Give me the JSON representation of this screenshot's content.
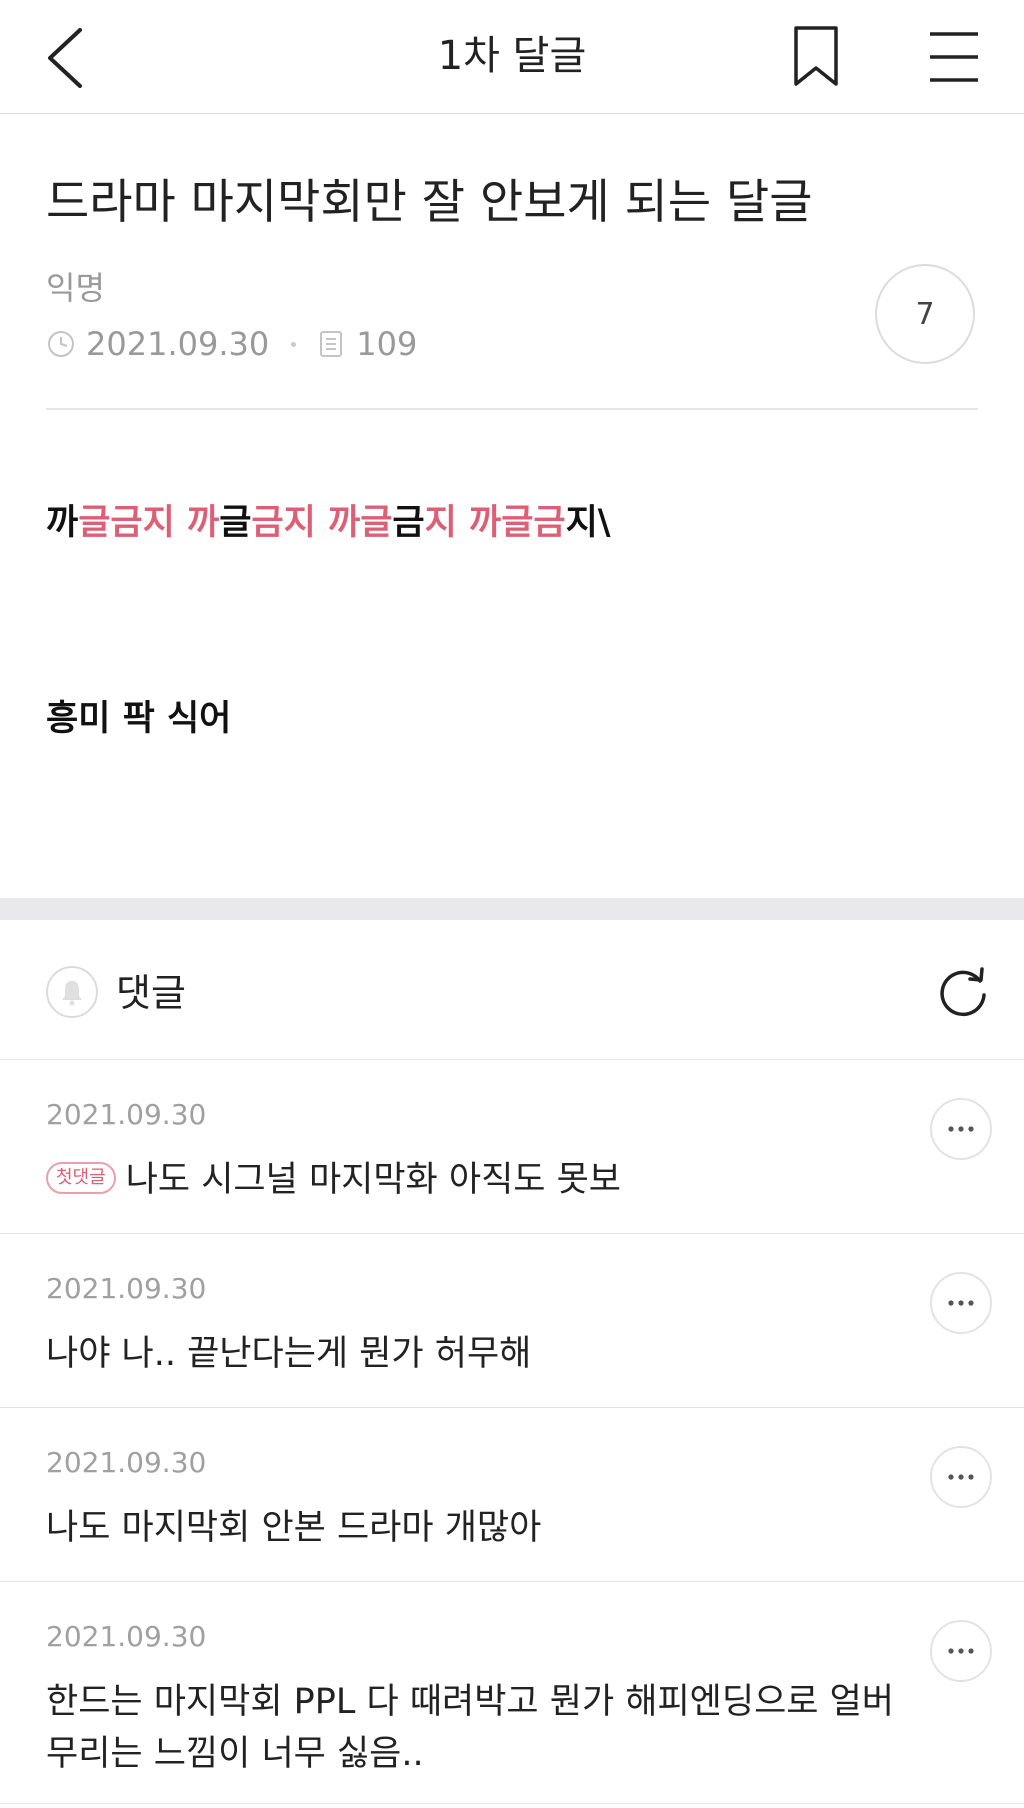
{
  "header": {
    "title": "1차 달글"
  },
  "post": {
    "title": "드라마 마지막회만 잘 안보게 되는 달글",
    "author": "익명",
    "date": "2021.09.30",
    "views": "109",
    "comment_count": "7",
    "body_line1_segments": [
      {
        "text": "까",
        "color": "black"
      },
      {
        "text": "글금지 까",
        "color": "pink"
      },
      {
        "text": "글",
        "color": "black"
      },
      {
        "text": "금지 까글",
        "color": "pink"
      },
      {
        "text": "금",
        "color": "black"
      },
      {
        "text": "지 까글금",
        "color": "pink"
      },
      {
        "text": "지\\",
        "color": "black"
      }
    ],
    "body_line2": "흥미 팍 식어"
  },
  "comments_section": {
    "label": "댓글",
    "items": [
      {
        "date": "2021.09.30",
        "badge": "첫댓글",
        "text": "나도 시그널 마지막화 아직도 못보"
      },
      {
        "date": "2021.09.30",
        "text": "나야 나.. 끝난다는게 뭔가 허무해"
      },
      {
        "date": "2021.09.30",
        "text": "나도 마지막회 안본 드라마 개많아"
      },
      {
        "date": "2021.09.30",
        "text": "한드는 마지막회 PPL 다 때려박고 뭔가 해피엔딩으로 얼버\n무리는 느낌이 너무 싫음.."
      }
    ]
  },
  "colors": {
    "accent_pink": "#dc5f75",
    "meta_gray": "#999999",
    "divider": "#e3e3e3",
    "section_band": "#e9e9eb"
  },
  "icons": {
    "back": "chevron-left-icon",
    "bookmark": "bookmark-icon",
    "menu": "hamburger-menu-icon",
    "clock": "clock-icon",
    "views": "document-icon",
    "bell": "bell-icon",
    "refresh": "refresh-icon",
    "more": "more-dots-icon"
  }
}
